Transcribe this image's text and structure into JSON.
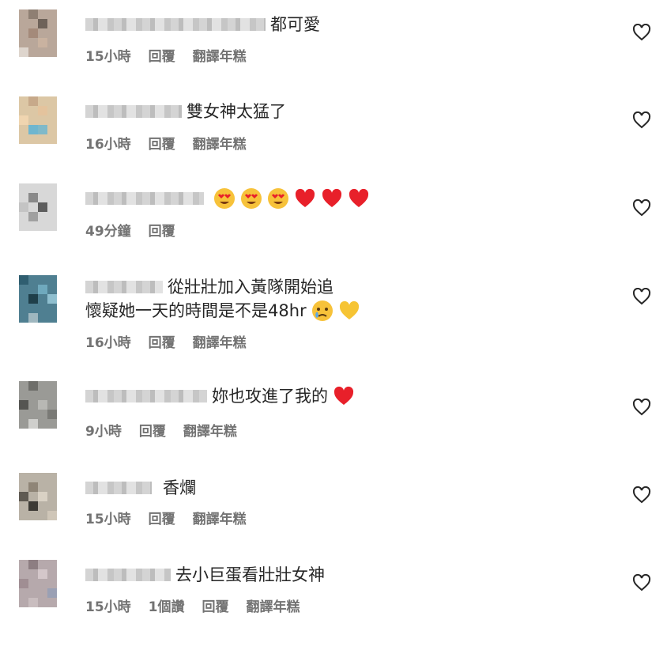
{
  "comments": [
    {
      "text": "都可愛",
      "time": "15小時",
      "likes": "",
      "reply": "回覆",
      "translate": "翻譯年糕",
      "emojis": []
    },
    {
      "text": "雙女神太猛了",
      "time": "16小時",
      "likes": "",
      "reply": "回覆",
      "translate": "翻譯年糕",
      "emojis": []
    },
    {
      "text": "",
      "time": "49分鐘",
      "likes": "",
      "reply": "回覆",
      "translate": "",
      "emojis": [
        "heart-eyes",
        "heart-eyes",
        "heart-eyes",
        "red-heart",
        "red-heart",
        "red-heart"
      ]
    },
    {
      "text": "從壯壯加入黃隊開始追",
      "text2": "懷疑她一天的時間是不是48hr",
      "time": "16小時",
      "likes": "",
      "reply": "回覆",
      "translate": "翻譯年糕",
      "emojis": [
        "crying-face",
        "yellow-heart"
      ]
    },
    {
      "text": "妳也攻進了我的",
      "time": "9小時",
      "likes": "",
      "reply": "回覆",
      "translate": "翻譯年糕",
      "emojis": [
        "red-heart"
      ]
    },
    {
      "text": "香爛",
      "time": "15小時",
      "likes": "",
      "reply": "回覆",
      "translate": "翻譯年糕",
      "emojis": []
    },
    {
      "text": "去小巨蛋看壯壯女神",
      "time": "15小時",
      "likes": "1個讚",
      "reply": "回覆",
      "translate": "翻譯年糕",
      "emojis": []
    }
  ],
  "colors": {
    "text": "#262626",
    "meta": "#737373",
    "heart_red": "#e8202a"
  }
}
